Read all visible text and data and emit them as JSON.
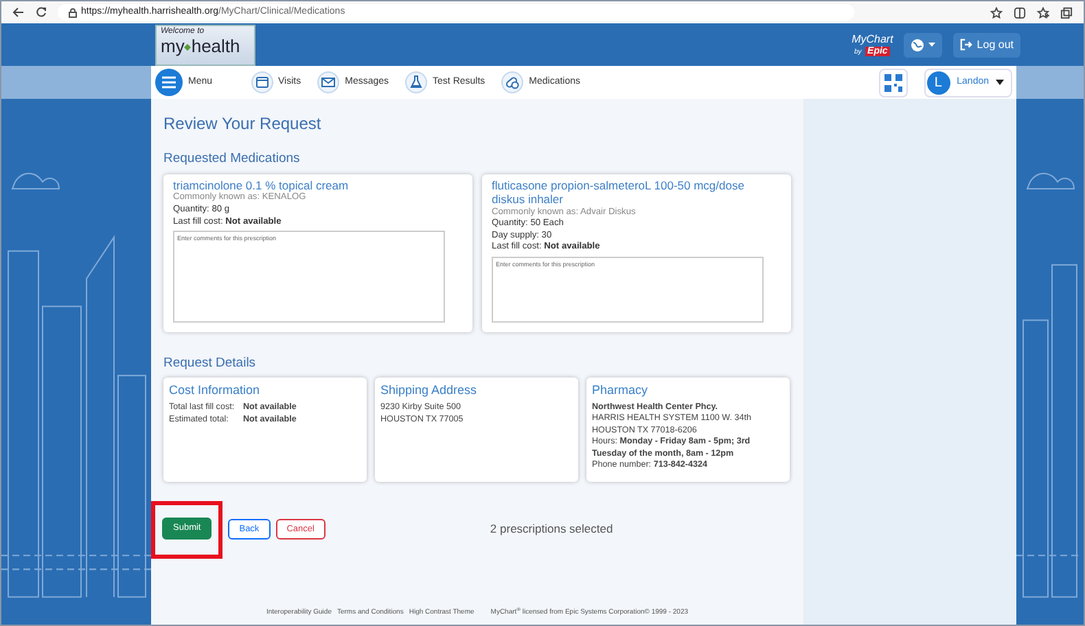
{
  "browser": {
    "url_host": "https://myhealth.harrishealth.org",
    "url_path": "/MyChart/Clinical/Medications"
  },
  "header": {
    "logo_welcome": "Welcome to",
    "logo_my": "my",
    "logo_health": "health",
    "mychart": "MyChart",
    "mychart_by": "by",
    "mychart_epic": "Epic",
    "logout": "Log out"
  },
  "nav": {
    "items": [
      {
        "kind": "menu",
        "label": "Menu"
      },
      {
        "kind": "visits",
        "label": "Visits"
      },
      {
        "kind": "messages",
        "label": "Messages"
      },
      {
        "kind": "test",
        "label": "Test Results"
      },
      {
        "kind": "meds",
        "label": "Medications"
      }
    ],
    "user_initial": "L",
    "user_name": "Landon"
  },
  "page_title": "Review Your Request",
  "medications_heading": "Requested Medications",
  "medications": [
    {
      "name": "triamcinolone 0.1 % topical cream",
      "known_as": "Commonly known as: KENALOG",
      "lines": [
        "Quantity: 80 g"
      ],
      "cost_label": "Last fill cost:",
      "cost_value": "Not available",
      "placeholder": "Enter comments for this prescription"
    },
    {
      "name": "fluticasone propion-salmeteroL 100-50 mcg/dose diskus inhaler",
      "known_as": "Commonly known as: Advair Diskus",
      "lines": [
        "Quantity: 50 Each",
        "Day supply: 30"
      ],
      "cost_label": "Last fill cost:",
      "cost_value": "Not available",
      "placeholder": "Enter comments for this prescription"
    }
  ],
  "details_heading": "Request Details",
  "cost": {
    "title": "Cost Information",
    "rows": [
      {
        "label": "Total last fill cost:",
        "value": "Not available"
      },
      {
        "label": "Estimated total:",
        "value": "Not available"
      }
    ]
  },
  "shipping": {
    "title": "Shipping Address",
    "lines": [
      "9230 Kirby Suite 500",
      "HOUSTON TX 77005"
    ]
  },
  "pharmacy": {
    "title": "Pharmacy",
    "name": "Northwest Health Center Phcy.",
    "lines": [
      "HARRIS HEALTH SYSTEM 1100 W. 34th",
      "HOUSTON TX 77018-6206"
    ],
    "hours_label": "Hours:",
    "hours": "Monday - Friday 8am - 5pm; 3rd Tuesday of the month, 8am - 12pm",
    "phone_label": "Phone number:",
    "phone": "713-842-4324"
  },
  "buttons": [
    {
      "kind": "success",
      "label": "Submit",
      "highlighted": true
    },
    {
      "kind": "outline-primary",
      "label": "Back",
      "highlighted": false
    },
    {
      "kind": "outline-danger",
      "label": "Cancel",
      "highlighted": false
    }
  ],
  "selection_status": "2 prescriptions selected",
  "footer": {
    "links": [
      "Interoperability Guide",
      "Terms and Conditions",
      "High Contrast Theme"
    ],
    "copyright": "MyChart$^{®}$ licensed from Epic Systems Corporation© 1999 - 2023"
  }
}
